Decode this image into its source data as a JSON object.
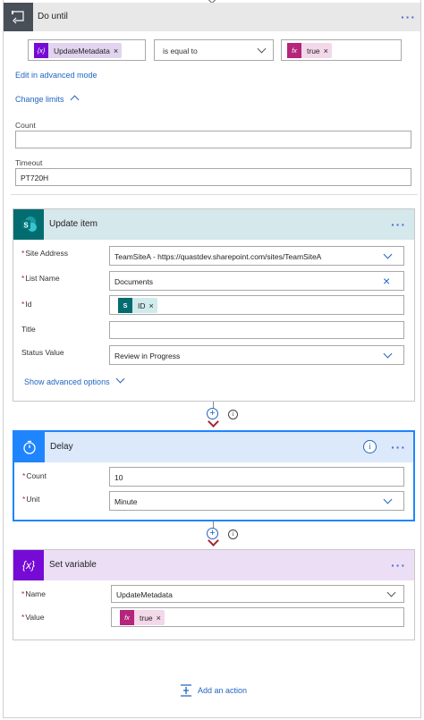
{
  "do_until": {
    "title": "Do until",
    "left_token": "UpdateMetadata",
    "left_token_icon": "{x}",
    "operator": "is equal to",
    "right_token": "true",
    "right_token_icon": "fx",
    "edit_advanced_label": "Edit in advanced mode",
    "change_limits_label": "Change limits",
    "count_label": "Count",
    "count_value": "",
    "timeout_label": "Timeout",
    "timeout_value": "PT720H"
  },
  "update_item": {
    "title": "Update item",
    "header_color": "#d5e8eb",
    "icon_color": "#036c70",
    "site_address_label": "Site Address",
    "site_address_value": "TeamSiteA - https://quastdev.sharepoint.com/sites/TeamSiteA",
    "list_name_label": "List Name",
    "list_name_value": "Documents",
    "id_label": "Id",
    "id_token": "ID",
    "title_label": "Title",
    "title_value": "",
    "status_label": "Status Value",
    "status_value": "Review in Progress",
    "advanced_options_label": "Show advanced options"
  },
  "delay": {
    "title": "Delay",
    "header_color": "#dbe9fb",
    "icon_color": "#1f85ff",
    "count_label": "Count",
    "count_value": "10",
    "unit_label": "Unit",
    "unit_value": "Minute"
  },
  "set_variable": {
    "title": "Set variable",
    "header_color": "#ecdff5",
    "icon_color": "#770bd6",
    "icon_text": "{x}",
    "name_label": "Name",
    "name_value": "UpdateMetadata",
    "value_label": "Value",
    "value_token": "true",
    "value_token_icon": "fx"
  },
  "add_action_label": "Add an action",
  "connector_plus": "+",
  "info_glyph": "i",
  "more_glyph": "···",
  "remove_glyph": "×",
  "required_mark": "*"
}
